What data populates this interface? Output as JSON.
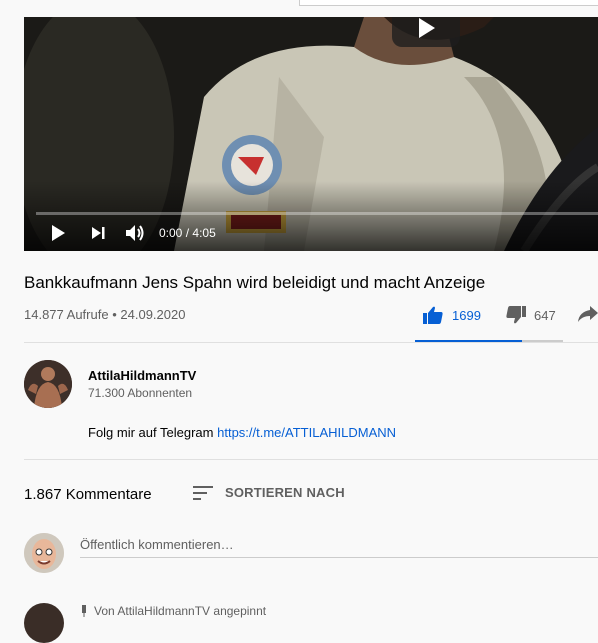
{
  "video": {
    "current_time": "0:00",
    "duration": "4:05",
    "progress_fraction": 0.0,
    "time_separator": "/"
  },
  "title": "Bankkaufmann Jens Spahn wird beleidigt und macht Anzeige",
  "meta": {
    "views": "14.877 Aufrufe",
    "separator": "•",
    "date": "24.09.2020"
  },
  "actions": {
    "likes": "1699",
    "dislikes": "647",
    "like_ratio": 0.724
  },
  "channel": {
    "name": "AttilaHildmannTV",
    "subscribers": "71.300 Abonnenten"
  },
  "description": {
    "text": "Folg mir auf Telegram",
    "link": "https://t.me/ATTILAHILDMANN"
  },
  "comments": {
    "count": "1.867 Kommentare",
    "sort_label": "SORTIEREN NACH",
    "input_placeholder": "Öffentlich kommentieren…",
    "pinned_label": "Von AttilaHildmannTV angepinnt"
  },
  "colors": {
    "accent": "#065fd4",
    "progress": "#ff0000",
    "secondary_text": "#606060"
  }
}
